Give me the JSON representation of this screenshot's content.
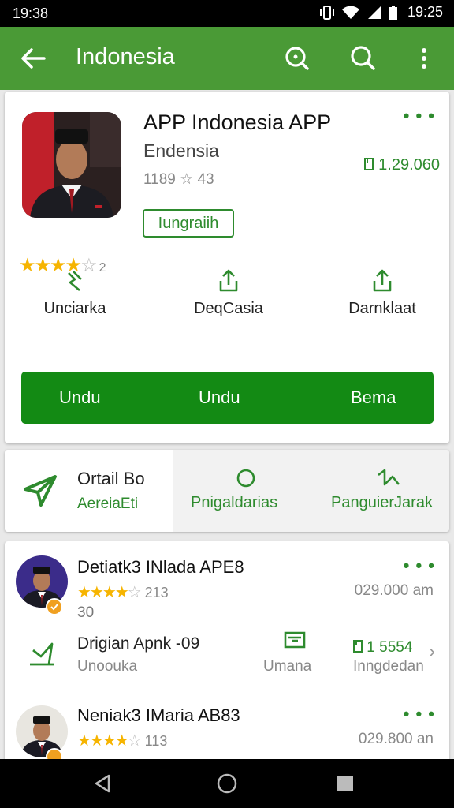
{
  "status_bar": {
    "time_left": "19:38",
    "time_right": "19:25"
  },
  "app_bar": {
    "title": "Indonesia"
  },
  "app_card": {
    "title": "APP Indonesia APP",
    "subtitle": "Endensia",
    "rating_text": "1189 ☆ 43",
    "price": "1.29.060",
    "install_label": "Iungraiih",
    "stars_value": "4",
    "stars_num": "2",
    "actions": [
      {
        "label": "Unciarka"
      },
      {
        "label": "DeqCasia"
      },
      {
        "label": "Darnklaat"
      }
    ],
    "buttons": [
      "Undu",
      "Undu",
      "Bema"
    ]
  },
  "tabs_card": {
    "title": "Ortail Bo",
    "subtitle": "AereiaEti",
    "tab2": "Pnigaldarias",
    "tab3": "PanguierJarak"
  },
  "list": [
    {
      "title": "Detiatk3 INlada APE8",
      "rating_num": "213",
      "extra": "30",
      "size": "029.000 am",
      "sub_name": "Drigian Apnk -09",
      "sub_label": "Unoouka",
      "sub_action": "Umana",
      "sub_price": "1 5554",
      "sub_price_label": "Inngdedan"
    },
    {
      "title": "Neniak3 IMaria AB83",
      "rating_num": "113",
      "size": "029.800 an"
    }
  ]
}
